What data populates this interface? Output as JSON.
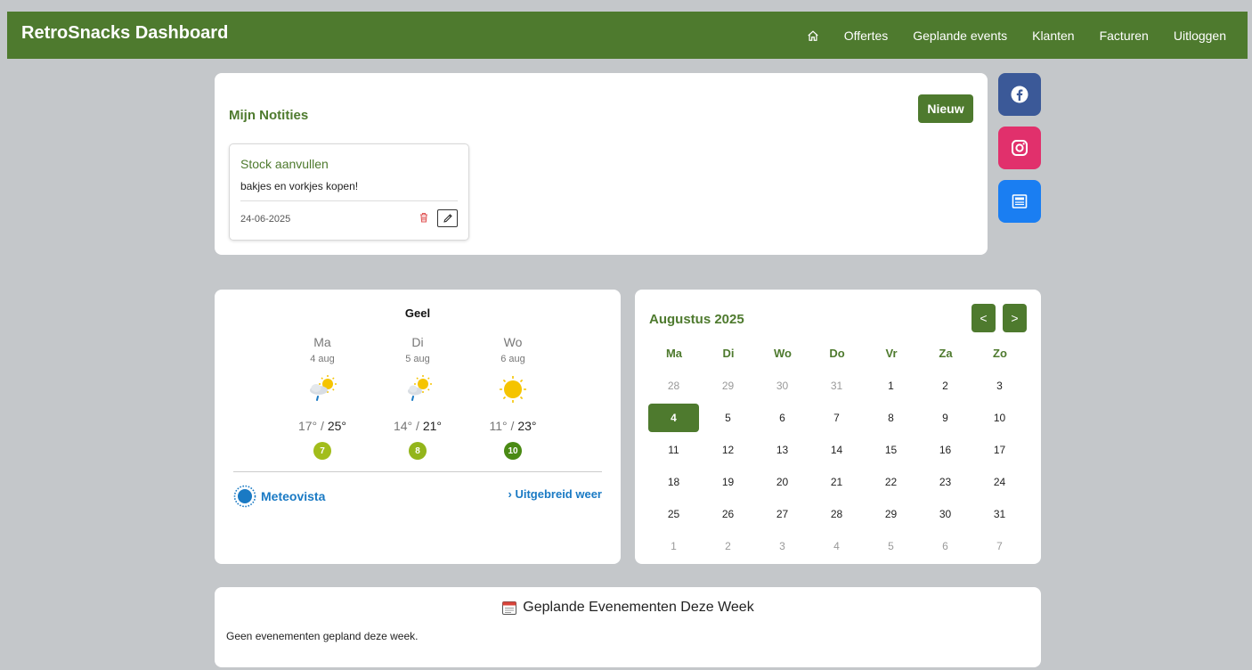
{
  "app": {
    "title": "RetroSnacks Dashboard"
  },
  "nav": {
    "home_icon": "home-icon",
    "items": [
      "Offertes",
      "Geplande events",
      "Klanten",
      "Facturen",
      "Uitloggen"
    ]
  },
  "notes": {
    "title": "Mijn Notities",
    "new_label": "Nieuw",
    "items": [
      {
        "title": "Stock aanvullen",
        "body": "bakjes en vorkjes kopen!",
        "date": "24-06-2025"
      }
    ]
  },
  "social": [
    {
      "name": "facebook",
      "icon": "facebook-icon",
      "color": "#3b5998"
    },
    {
      "name": "instagram",
      "icon": "instagram-icon",
      "color": "#e1306c"
    },
    {
      "name": "newsletter",
      "icon": "newspaper-icon",
      "color": "#1a7ef2"
    }
  ],
  "weather": {
    "city": "Geel",
    "days": [
      {
        "name": "Ma",
        "date": "4 aug",
        "icon": "sun-cloud-rain-icon",
        "low": "17°",
        "high": "25°",
        "index": "7",
        "index_color": "#a2bd1b"
      },
      {
        "name": "Di",
        "date": "5 aug",
        "icon": "sun-cloud-rain-icon",
        "low": "14°",
        "high": "21°",
        "index": "8",
        "index_color": "#93b51b"
      },
      {
        "name": "Wo",
        "date": "6 aug",
        "icon": "sun-icon",
        "low": "11°",
        "high": "23°",
        "index": "10",
        "index_color": "#4a8a14"
      }
    ],
    "brand": "Meteovista",
    "link": "Uitgebreid weer"
  },
  "calendar": {
    "title": "Augustus 2025",
    "prev": "<",
    "next": ">",
    "weekdays": [
      "Ma",
      "Di",
      "Wo",
      "Do",
      "Vr",
      "Za",
      "Zo"
    ],
    "weeks": [
      [
        "28",
        "29",
        "30",
        "31",
        "1",
        "2",
        "3"
      ],
      [
        "4",
        "5",
        "6",
        "7",
        "8",
        "9",
        "10"
      ],
      [
        "11",
        "12",
        "13",
        "14",
        "15",
        "16",
        "17"
      ],
      [
        "18",
        "19",
        "20",
        "21",
        "22",
        "23",
        "24"
      ],
      [
        "25",
        "26",
        "27",
        "28",
        "29",
        "30",
        "31"
      ],
      [
        "1",
        "2",
        "3",
        "4",
        "5",
        "6",
        "7"
      ]
    ],
    "today": "4"
  },
  "events": {
    "icon": "calendar-icon",
    "title": "Geplande Evenementen Deze Week",
    "empty": "Geen evenementen gepland deze week."
  }
}
